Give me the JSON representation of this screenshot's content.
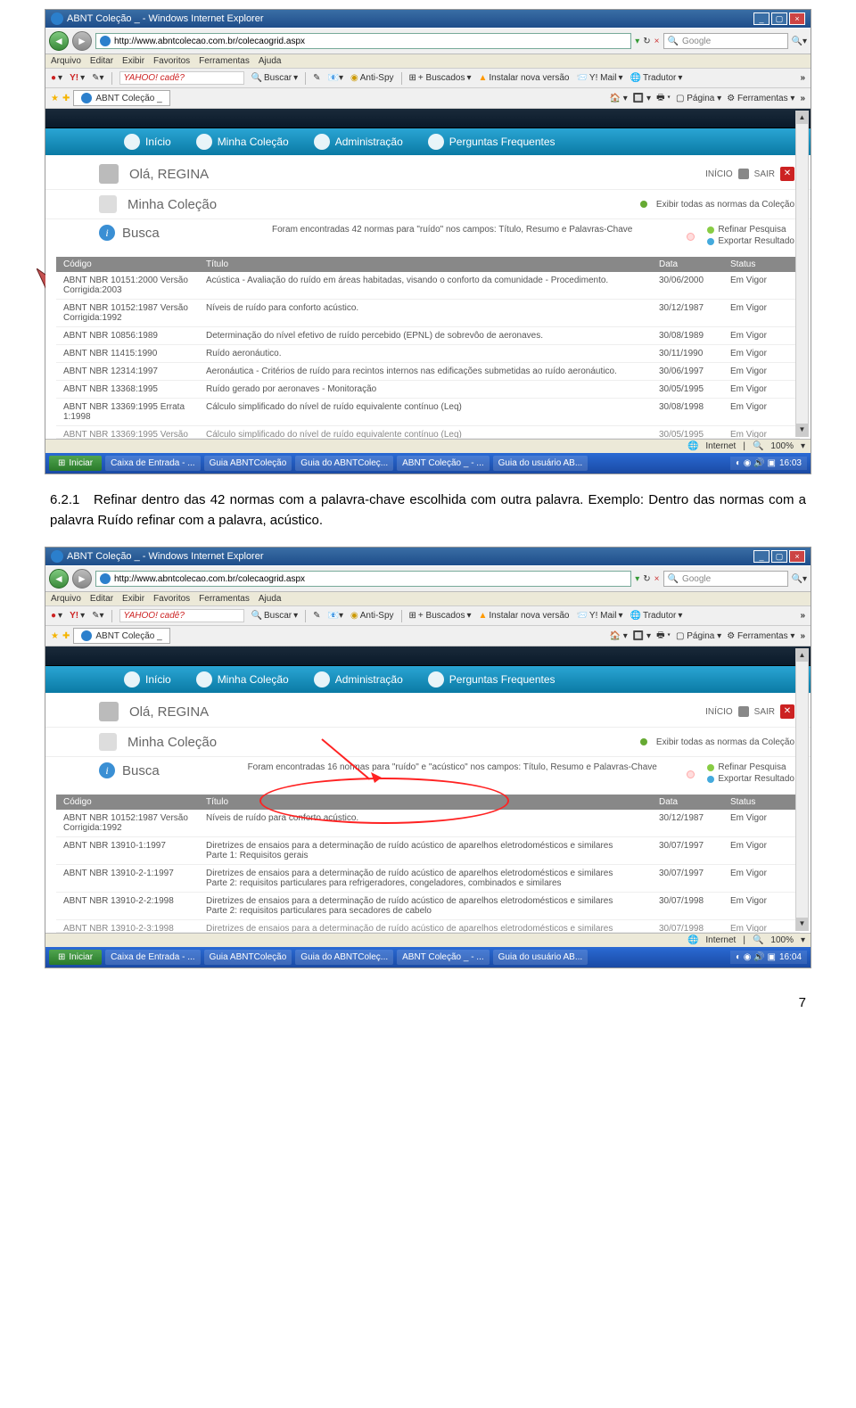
{
  "browser": {
    "window_title": "ABNT Coleção _ - Windows Internet Explorer",
    "url": "http://www.abntcolecao.com.br/colecaogrid.aspx",
    "search_engine": "Google",
    "menus": [
      "Arquivo",
      "Editar",
      "Exibir",
      "Favoritos",
      "Ferramentas",
      "Ajuda"
    ],
    "toolbar2": {
      "yahoo_prompt": "YAHOO! cadê?",
      "buscar": "Buscar",
      "antispy": "Anti-Spy",
      "buscados": "+ Buscados",
      "instalar": "Instalar nova versão",
      "ymail": "Y! Mail",
      "tradutor": "Tradutor"
    },
    "tab_label": "ABNT Coleção _",
    "page_ctrl": "Página",
    "tools_ctrl": "Ferramentas",
    "status_internet": "Internet",
    "zoom": "100%"
  },
  "site": {
    "nav": {
      "inicio": "Início",
      "minha": "Minha Coleção",
      "admin": "Administração",
      "faq": "Perguntas Frequentes"
    },
    "greeting": "Olá, REGINA",
    "link_inicio": "INÍCIO",
    "link_sair": "SAIR",
    "section_title": "Minha Coleção",
    "exibir_todas": "Exibir todas as normas da Coleção",
    "busca_label": "Busca",
    "refinar": "Refinar Pesquisa",
    "exportar": "Exportar Resultado",
    "headers": {
      "codigo": "Código",
      "titulo": "Título",
      "data": "Data",
      "status": "Status"
    }
  },
  "shot1": {
    "result_msg": "Foram encontradas 42 normas para \"ruído\" nos campos: Título, Resumo e Palavras-Chave",
    "rows": [
      {
        "codigo": "ABNT NBR 10151:2000 Versão Corrigida:2003",
        "titulo": "Acústica - Avaliação do ruído em áreas habitadas, visando o conforto da comunidade - Procedimento.",
        "data": "30/06/2000",
        "status": "Em Vigor"
      },
      {
        "codigo": "ABNT NBR 10152:1987 Versão Corrigida:1992",
        "titulo": "Níveis de ruído para conforto acústico.",
        "data": "30/12/1987",
        "status": "Em Vigor"
      },
      {
        "codigo": "ABNT NBR 10856:1989",
        "titulo": "Determinação do nível efetivo de ruído percebido (EPNL) de sobrevôo de aeronaves.",
        "data": "30/08/1989",
        "status": "Em Vigor"
      },
      {
        "codigo": "ABNT NBR 11415:1990",
        "titulo": "Ruído aeronáutico.",
        "data": "30/11/1990",
        "status": "Em Vigor"
      },
      {
        "codigo": "ABNT NBR 12314:1997",
        "titulo": "Aeronáutica - Critérios de ruído para recintos internos nas edificações submetidas ao ruído aeronáutico.",
        "data": "30/06/1997",
        "status": "Em Vigor"
      },
      {
        "codigo": "ABNT NBR 13368:1995",
        "titulo": "Ruído gerado por aeronaves - Monitoração",
        "data": "30/05/1995",
        "status": "Em Vigor"
      },
      {
        "codigo": "ABNT NBR 13369:1995 Errata 1:1998",
        "titulo": "Cálculo simplificado do nível de ruído equivalente contínuo (Leq)",
        "data": "30/08/1998",
        "status": "Em Vigor"
      }
    ],
    "cut_row": {
      "codigo": "ABNT NBR 13369:1995 Versão",
      "titulo": "Cálculo simplificado do nível de ruído equivalente contínuo (Leq)",
      "data": "30/05/1995",
      "status": "Em Vigor"
    }
  },
  "body_text": {
    "section_num": "6.2.1",
    "line1": "Refinar dentro das 42 normas com a palavra-chave escolhida com outra palavra.",
    "line2": "Exemplo: Dentro das normas com a palavra Ruído refinar com a palavra, acústico."
  },
  "shot2": {
    "result_msg": "Foram encontradas 16 normas para \"ruído\" e \"acústico\" nos campos: Título, Resumo e Palavras-Chave",
    "rows": [
      {
        "codigo": "ABNT NBR 10152:1987 Versão Corrigida:1992",
        "titulo": "Níveis de ruído para conforto acústico.",
        "data": "30/12/1987",
        "status": "Em Vigor"
      },
      {
        "codigo": "ABNT NBR 13910-1:1997",
        "titulo": "Diretrizes de ensaios para a determinação de ruído acústico de aparelhos eletrodomésticos e similares\nParte 1: Requisitos gerais",
        "data": "30/07/1997",
        "status": "Em Vigor"
      },
      {
        "codigo": "ABNT NBR 13910-2-1:1997",
        "titulo": "Diretrizes de ensaios para a determinação de ruído acústico de aparelhos eletrodomésticos e similares\nParte 2: requisitos particulares para refrigeradores, congeladores, combinados e similares",
        "data": "30/07/1997",
        "status": "Em Vigor"
      },
      {
        "codigo": "ABNT NBR 13910-2-2:1998",
        "titulo": "Diretrizes de ensaios para a determinação de ruído acústico de aparelhos eletrodomésticos e similares\nParte 2: requisitos particulares para secadores de cabelo",
        "data": "30/07/1998",
        "status": "Em Vigor"
      }
    ],
    "cut_row": {
      "codigo": "ABNT NBR 13910-2-3:1998",
      "titulo": "Diretrizes de ensaios para a determinação de ruído acústico de aparelhos eletrodomésticos e similares",
      "data": "30/07/1998",
      "status": "Em Vigor"
    }
  },
  "taskbar": {
    "start": "Iniciar",
    "items1": [
      "Caixa de Entrada - ...",
      "Guia ABNTColeção",
      "Guia do ABNTColeç...",
      "ABNT Coleção _ - ...",
      "Guia do usuário AB..."
    ],
    "time1": "16:03",
    "items2": [
      "Caixa de Entrada - ...",
      "Guia ABNTColeção",
      "Guia do ABNTColeç...",
      "ABNT Coleção _ - ...",
      "Guia do usuário AB..."
    ],
    "time2": "16:04"
  },
  "page_number": "7"
}
